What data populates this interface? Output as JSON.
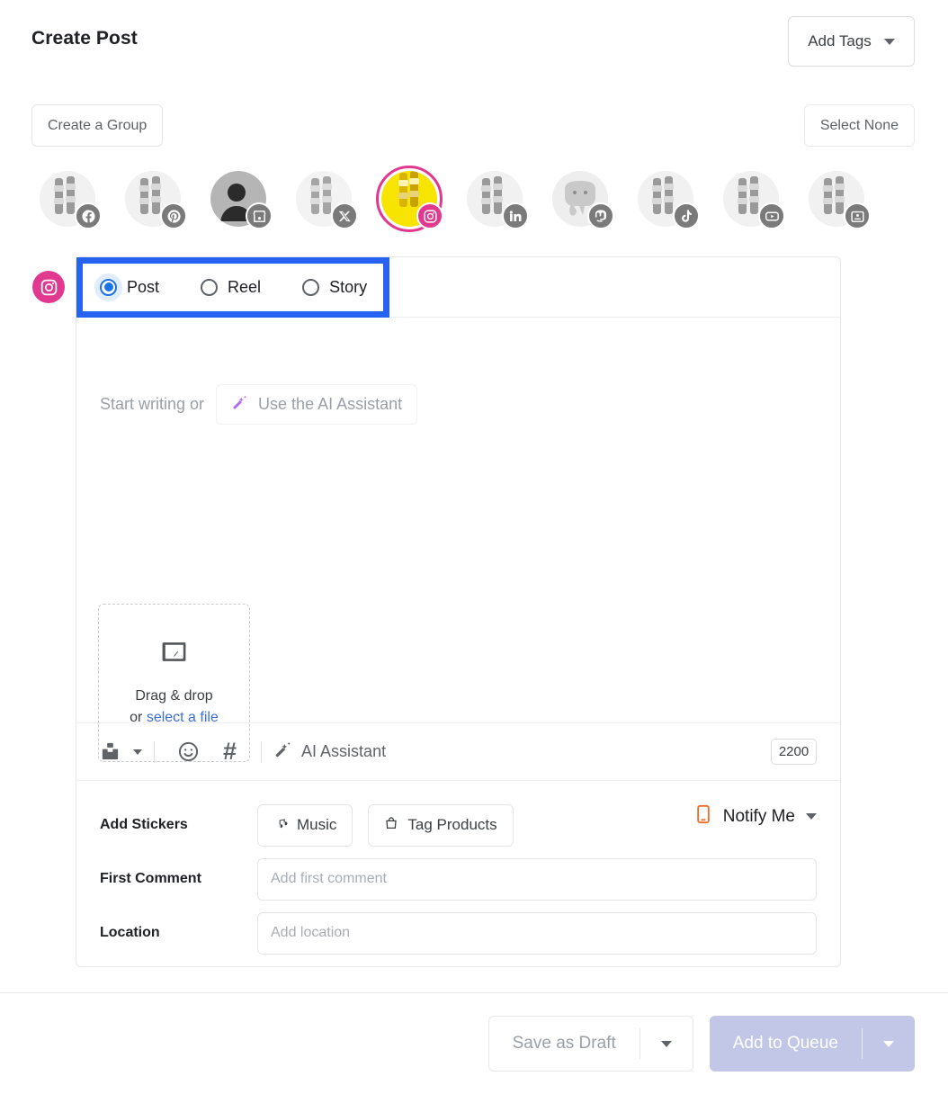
{
  "header": {
    "title": "Create Post",
    "add_tags_label": "Add Tags"
  },
  "groups": {
    "create_group_label": "Create a Group",
    "select_none_label": "Select None"
  },
  "accounts": [
    {
      "network": "facebook",
      "icon": "facebook-icon",
      "selected": false,
      "avatar": "photo"
    },
    {
      "network": "pinterest",
      "icon": "pinterest-icon",
      "selected": false,
      "avatar": "photo"
    },
    {
      "network": "google-business",
      "icon": "storefront-icon",
      "selected": false,
      "avatar": "person"
    },
    {
      "network": "x",
      "icon": "x-icon",
      "selected": false,
      "avatar": "photo"
    },
    {
      "network": "instagram",
      "icon": "instagram-icon",
      "selected": true,
      "avatar": "photo-color"
    },
    {
      "network": "linkedin",
      "icon": "linkedin-icon",
      "selected": false,
      "avatar": "photo"
    },
    {
      "network": "mastodon",
      "icon": "mastodon-icon",
      "selected": false,
      "avatar": "elephant"
    },
    {
      "network": "tiktok",
      "icon": "tiktok-icon",
      "selected": false,
      "avatar": "photo"
    },
    {
      "network": "youtube",
      "icon": "youtube-icon",
      "selected": false,
      "avatar": "photo"
    },
    {
      "network": "google-business-profile",
      "icon": "profile-card-icon",
      "selected": false,
      "avatar": "photo"
    }
  ],
  "editor": {
    "network_badge_icon": "instagram-icon",
    "post_types": [
      {
        "label": "Post",
        "checked": true
      },
      {
        "label": "Reel",
        "checked": false
      },
      {
        "label": "Story",
        "checked": false
      }
    ],
    "placeholder_prefix": "Start writing or",
    "ai_chip_label": "Use the AI Assistant",
    "dropzone": {
      "line1": "Drag & drop",
      "or": "or ",
      "link": "select a file"
    },
    "toolbar": {
      "upload_icon": "upload-icon",
      "emoji_icon": "emoji-icon",
      "hashtag_icon": "hashtag-icon",
      "ai_icon": "magic-wand-icon",
      "ai_label": "AI Assistant",
      "char_count": "2200"
    },
    "options": {
      "stickers_label": "Add Stickers",
      "music_label": "Music",
      "tag_products_label": "Tag Products",
      "notify_label": "Notify Me",
      "first_comment_label": "First Comment",
      "first_comment_placeholder": "Add first comment",
      "first_comment_value": "",
      "location_label": "Location",
      "location_placeholder": "Add location",
      "location_value": ""
    }
  },
  "footer": {
    "save_draft_label": "Save as Draft",
    "add_queue_label": "Add to Queue"
  },
  "colors": {
    "instagram": "#e0398f",
    "annotation": "#2563f0",
    "radio_active": "#1a73e8",
    "queue_button": "#c2c7e8",
    "notify_orange": "#ef6c28",
    "link_blue": "#3b6fd4"
  }
}
